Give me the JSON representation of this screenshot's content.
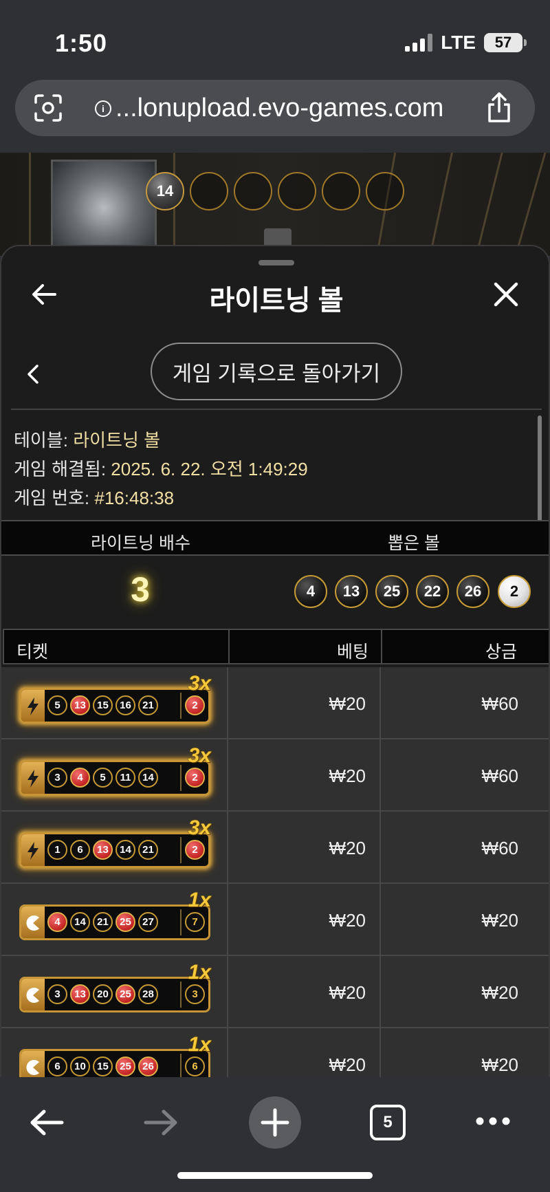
{
  "status_bar": {
    "time": "1:50",
    "network": "LTE",
    "battery": "57"
  },
  "url_bar": {
    "url": "...lonupload.evo-games.com"
  },
  "game_backdrop": {
    "drawn_balls": [
      "14",
      "",
      "",
      "",
      "",
      ""
    ]
  },
  "sheet": {
    "title": "라이트닝 볼",
    "back_to_history_label": "게임 기록으로 돌아가기",
    "info": {
      "table_label": "테이블:",
      "table_value": "라이트닝 볼",
      "resolved_label": "게임 해결됨:",
      "resolved_value": "2025. 6. 22. 오전 1:49:29",
      "game_number_label": "게임 번호:",
      "game_number_value": "#16:48:38"
    },
    "summary": {
      "multiplier_header": "라이트닝 배수",
      "drawn_header": "뽑은 볼",
      "multiplier_value": "3",
      "drawn_balls": [
        "4",
        "13",
        "25",
        "22",
        "26",
        "2"
      ]
    },
    "table": {
      "headers": {
        "ticket": "티켓",
        "bet": "베팅",
        "prize": "상금"
      },
      "rows": [
        {
          "multiplier": "3x",
          "lightning": true,
          "numbers": [
            "5",
            "13",
            "15",
            "16",
            "21"
          ],
          "red": [
            "13"
          ],
          "bonus": "2",
          "bonus_red": true,
          "bet": "₩20",
          "prize": "₩60"
        },
        {
          "multiplier": "3x",
          "lightning": true,
          "numbers": [
            "3",
            "4",
            "5",
            "11",
            "14"
          ],
          "red": [
            "4"
          ],
          "bonus": "2",
          "bonus_red": true,
          "bet": "₩20",
          "prize": "₩60"
        },
        {
          "multiplier": "3x",
          "lightning": true,
          "numbers": [
            "1",
            "6",
            "13",
            "14",
            "21"
          ],
          "red": [
            "13"
          ],
          "bonus": "2",
          "bonus_red": true,
          "bet": "₩20",
          "prize": "₩60"
        },
        {
          "multiplier": "1x",
          "lightning": false,
          "numbers": [
            "4",
            "14",
            "21",
            "25",
            "27"
          ],
          "red": [
            "4",
            "25"
          ],
          "bonus": "7",
          "bonus_red": false,
          "bet": "₩20",
          "prize": "₩20"
        },
        {
          "multiplier": "1x",
          "lightning": false,
          "numbers": [
            "3",
            "13",
            "20",
            "25",
            "28"
          ],
          "red": [
            "13",
            "25"
          ],
          "bonus": "3",
          "bonus_red": false,
          "bet": "₩20",
          "prize": "₩20"
        },
        {
          "multiplier": "1x",
          "lightning": false,
          "numbers": [
            "6",
            "10",
            "15",
            "25",
            "26"
          ],
          "red": [
            "25",
            "26"
          ],
          "bonus": "6",
          "bonus_red": false,
          "bet": "₩20",
          "prize": "₩20"
        }
      ]
    }
  },
  "bottom_nav": {
    "tab_count": "5"
  },
  "colors": {
    "accent_gold": "#c79a35",
    "ball_red": "#c42525",
    "multiplier_glow": "#e8cf45"
  },
  "icons": [
    "camera-scan-icon",
    "info-icon",
    "share-icon",
    "back-arrow-icon",
    "close-icon",
    "chevron-left-icon",
    "lightning-icon",
    "pacman-icon",
    "forward-arrow-icon",
    "plus-icon",
    "tabs-icon",
    "more-icon"
  ]
}
